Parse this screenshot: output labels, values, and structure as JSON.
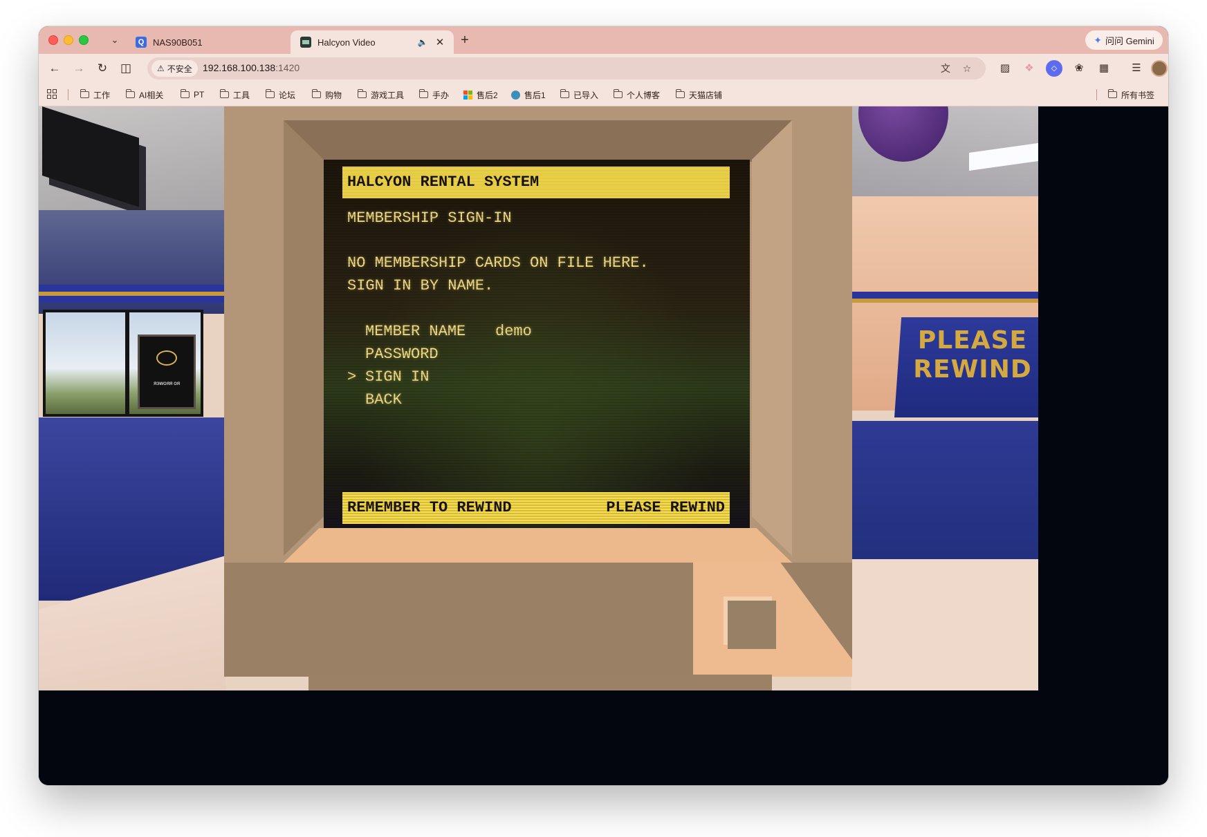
{
  "browser": {
    "tabs": [
      {
        "title": "NAS90B051",
        "favicon": "nas-favicon",
        "active": false
      },
      {
        "title": "Halcyon Video",
        "favicon": "video-favicon",
        "active": true,
        "audio": true
      }
    ],
    "new_tab_label": "+",
    "gemini_label": "问问 Gemini",
    "security_label": "不安全",
    "url_host": "192.168.100.138",
    "url_port": ":1420",
    "bookmarks": [
      {
        "label": "工作",
        "icon": "folder-icon"
      },
      {
        "label": "AI相关",
        "icon": "folder-icon"
      },
      {
        "label": "PT",
        "icon": "folder-icon"
      },
      {
        "label": "工具",
        "icon": "folder-icon"
      },
      {
        "label": "论坛",
        "icon": "folder-icon"
      },
      {
        "label": "购物",
        "icon": "folder-icon"
      },
      {
        "label": "游戏工具",
        "icon": "folder-icon"
      },
      {
        "label": "手办",
        "icon": "folder-icon"
      },
      {
        "label": "售后2",
        "icon": "microsoft-icon"
      },
      {
        "label": "售后1",
        "icon": "globe-icon"
      },
      {
        "label": "已导入",
        "icon": "folder-icon"
      },
      {
        "label": "个人博客",
        "icon": "folder-icon"
      },
      {
        "label": "天猫店铺",
        "icon": "folder-icon"
      }
    ],
    "all_bookmarks_label": "所有书签",
    "colors": {
      "tabstrip": "#e8b9b0",
      "toolbar": "#f5e3de",
      "omnibox": "#ead2cc"
    }
  },
  "game": {
    "header": "HALCYON RENTAL SYSTEM",
    "section_title": "MEMBERSHIP SIGN-IN",
    "message_line1": "NO MEMBERSHIP CARDS ON FILE HERE.",
    "message_line2": "SIGN IN BY NAME.",
    "menu": {
      "cursor": ">",
      "member_name_label": "MEMBER NAME",
      "member_name_value": "demo",
      "password_label": "PASSWORD",
      "sign_in_label": "SIGN IN",
      "back_label": "BACK",
      "selected": "SIGN IN"
    },
    "footer_left": "REMEMBER TO REWIND",
    "footer_right": "PLEASE REWIND",
    "store_sign": "PLEASE REWIND",
    "poster_text": "ЯЭWOЯЯ ОЯ",
    "colors": {
      "crt_bar": "#f6dc4f",
      "crt_text": "#f2dc86",
      "bezel": "#b39677",
      "sign": "#2d3a9a",
      "sign_text": "#d5a942"
    }
  }
}
